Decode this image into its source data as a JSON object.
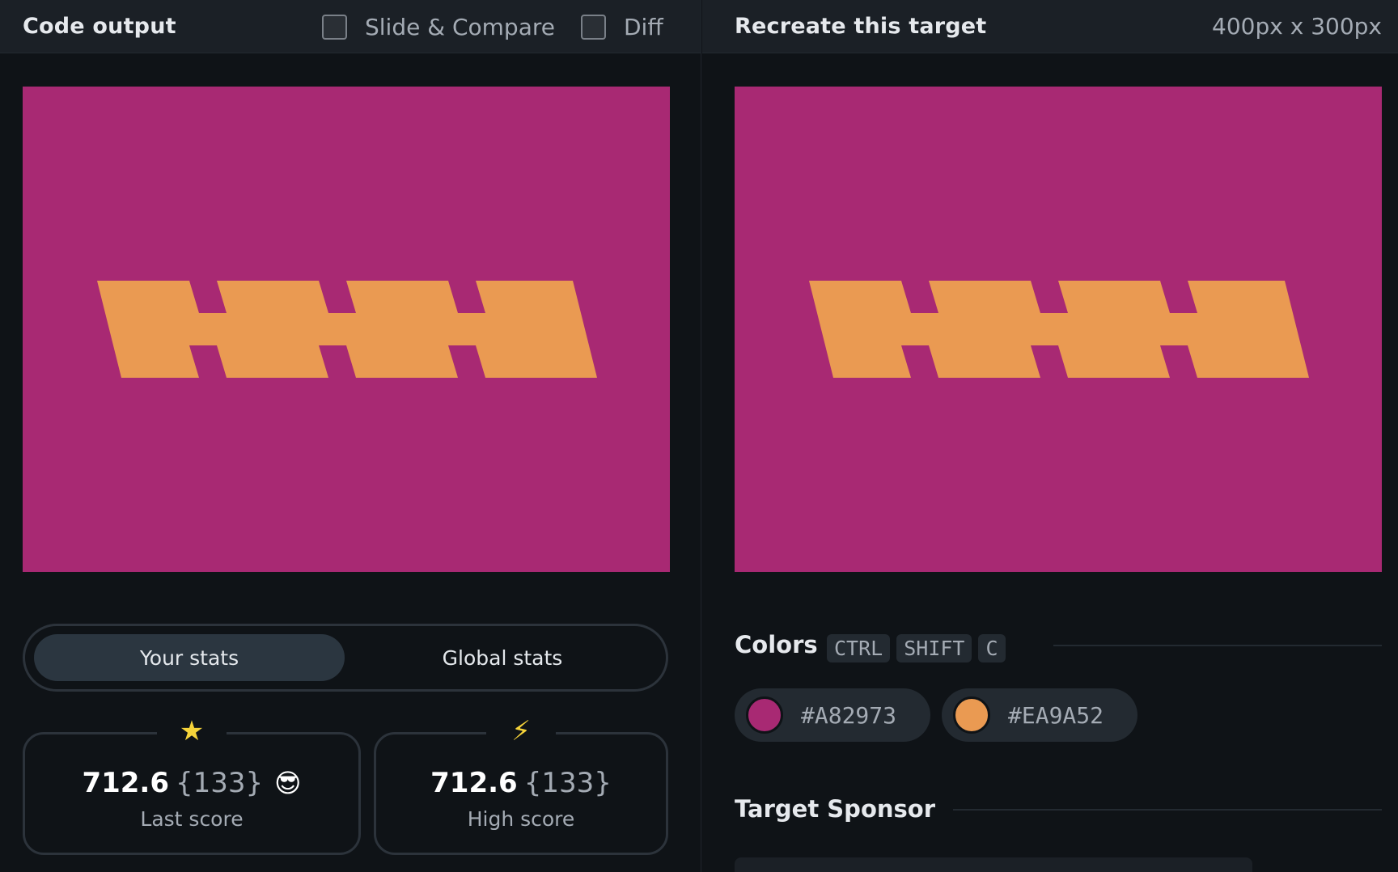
{
  "left_header": {
    "title": "Code output",
    "slide_compare_label": "Slide & Compare",
    "diff_label": "Diff"
  },
  "right_header": {
    "title": "Recreate this target",
    "dimensions": "400px x 300px"
  },
  "canvas": {
    "background_color": "#A82973",
    "shape_color": "#EA9A52"
  },
  "stats_toggle": {
    "your_stats": "Your stats",
    "global_stats": "Global stats"
  },
  "last_score": {
    "value": "712.6",
    "count": "{133}",
    "emoji": "😎",
    "label": "Last score",
    "icon": "star-icon"
  },
  "high_score": {
    "value": "712.6",
    "count": "{133}",
    "label": "High score",
    "icon": "bolt-icon"
  },
  "colors": {
    "title": "Colors",
    "shortcut": [
      "CTRL",
      "SHIFT",
      "C"
    ],
    "swatches": [
      {
        "hex": "#A82973"
      },
      {
        "hex": "#EA9A52"
      }
    ]
  },
  "sponsor": {
    "title": "Target Sponsor"
  }
}
